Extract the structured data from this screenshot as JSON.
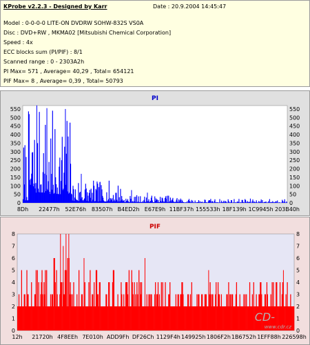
{
  "info": {
    "app_title": "KProbe v2.2.3 - Designed by Karr",
    "date": "Date : 20.9.2004 14:45:47",
    "model": "Model : 0-0-0-0 LITE-ON DVDRW SOHW-832S  VS0A",
    "disc": "Disc : DVD+RW ,  MKMA02 [Mitsubishi Chemical Corporation]",
    "speed": "Speed : 4x",
    "ecc": "ECC blocks sum (PI/PIF) : 8/1",
    "range": "Scanned range : 0 - 2303A2h",
    "pi_stats": "PI Max= 571 , Average= 40,29 , Total= 654121",
    "pif_stats": "PIF Max= 8 , Average= 0,39 , Total= 50793"
  },
  "watermark": "CD-",
  "watermark_url": "www.cdr.cz",
  "colors": {
    "pi_bar": "#0000ff",
    "pif_bar": "#ff0000",
    "pi_plot_bg": "#ffffff",
    "pif_plot_bg": "#e6e6f5",
    "pi_title": "#0000cc",
    "pif_title": "#cc0000"
  },
  "chart_data": [
    {
      "type": "bar",
      "title": "PI",
      "xlabel": "",
      "ylabel": "",
      "ylim": [
        0,
        570
      ],
      "yticks": [
        0,
        50,
        100,
        150,
        200,
        250,
        300,
        350,
        400,
        450,
        500,
        550
      ],
      "x_tick_labels": [
        "8Dh",
        "22477h",
        "52E76h",
        "83507h",
        "B4ED2h",
        "E67E9h",
        "11BF37h",
        "155533h",
        "18F139h",
        "1C9945h",
        "203B40h"
      ],
      "grid": false,
      "profile": [
        {
          "from": 0.0,
          "to": 0.02,
          "base": 15,
          "peak": 420
        },
        {
          "from": 0.02,
          "to": 0.1,
          "base": 60,
          "peak": 560
        },
        {
          "from": 0.1,
          "to": 0.185,
          "base": 50,
          "peak": 540
        },
        {
          "from": 0.185,
          "to": 0.25,
          "base": 10,
          "peak": 170
        },
        {
          "from": 0.25,
          "to": 0.38,
          "base": 8,
          "peak": 130
        },
        {
          "from": 0.38,
          "to": 0.6,
          "base": 4,
          "peak": 45
        },
        {
          "from": 0.6,
          "to": 1.0,
          "base": 2,
          "peak": 25
        }
      ],
      "spikes": [
        {
          "x": 0.052,
          "value": 571
        },
        {
          "x": 0.09,
          "value": 555
        },
        {
          "x": 0.16,
          "value": 550
        },
        {
          "x": 0.22,
          "value": 170
        },
        {
          "x": 0.29,
          "value": 120
        },
        {
          "x": 0.41,
          "value": 75
        },
        {
          "x": 0.47,
          "value": 60
        },
        {
          "x": 0.54,
          "value": 40
        }
      ]
    },
    {
      "type": "bar",
      "title": "PIF",
      "xlabel": "",
      "ylabel": "",
      "ylim": [
        0,
        8
      ],
      "yticks": [
        0,
        1,
        2,
        3,
        4,
        5,
        6,
        7,
        8
      ],
      "x_tick_labels": [
        "12h",
        "21720h",
        "4F8EEh",
        "7E010h",
        "ADD9Fh",
        "DF26Ch",
        "1129F4h",
        "149925h",
        "1806F2h",
        "1B6752h",
        "1EFF88h",
        "226598h"
      ],
      "grid": false,
      "profile": [
        {
          "from": 0.0,
          "to": 0.08,
          "base": 2,
          "peak": 5
        },
        {
          "from": 0.08,
          "to": 0.2,
          "base": 2,
          "peak": 6
        },
        {
          "from": 0.2,
          "to": 0.45,
          "base": 2,
          "peak": 5
        },
        {
          "from": 0.45,
          "to": 1.0,
          "base": 2,
          "peak": 4
        }
      ],
      "spikes": [
        {
          "x": 0.155,
          "value": 8
        },
        {
          "x": 0.165,
          "value": 7
        },
        {
          "x": 0.175,
          "value": 8
        },
        {
          "x": 0.185,
          "value": 8
        },
        {
          "x": 0.24,
          "value": 6
        },
        {
          "x": 0.46,
          "value": 6
        },
        {
          "x": 0.69,
          "value": 5
        },
        {
          "x": 0.96,
          "value": 5
        }
      ]
    }
  ]
}
